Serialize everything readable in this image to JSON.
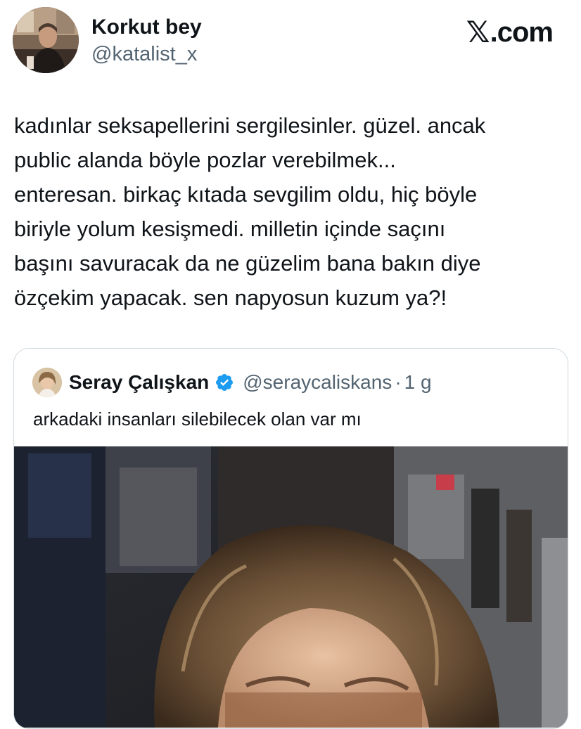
{
  "author": {
    "name": "Korkut bey",
    "handle": "@katalist_x"
  },
  "brand": {
    "logo_glyph": "𝕏",
    "text": ".com"
  },
  "tweet": {
    "text": "kadınlar seksapellerini sergilesinler. güzel. ancak\npublic alanda böyle pozlar verebilmek...\nenteresan. birkaç kıtada sevgilim oldu, hiç böyle\nbiriyle yolum kesişmedi. milletin içinde saçını\nbaşını savuracak da ne güzelim bana bakın diye\nözçekim yapacak. sen napyosun kuzum ya?!"
  },
  "quote": {
    "name": "Seray Çalışkan",
    "handle": "@seraycaliskans",
    "separator": "·",
    "time": "1 g",
    "text": "arkadaki insanları silebilecek olan var mı",
    "verified": true
  },
  "colors": {
    "text": "#0f1419",
    "secondary": "#536471",
    "border": "#cfd9de",
    "verified_blue": "#1d9bf0"
  }
}
